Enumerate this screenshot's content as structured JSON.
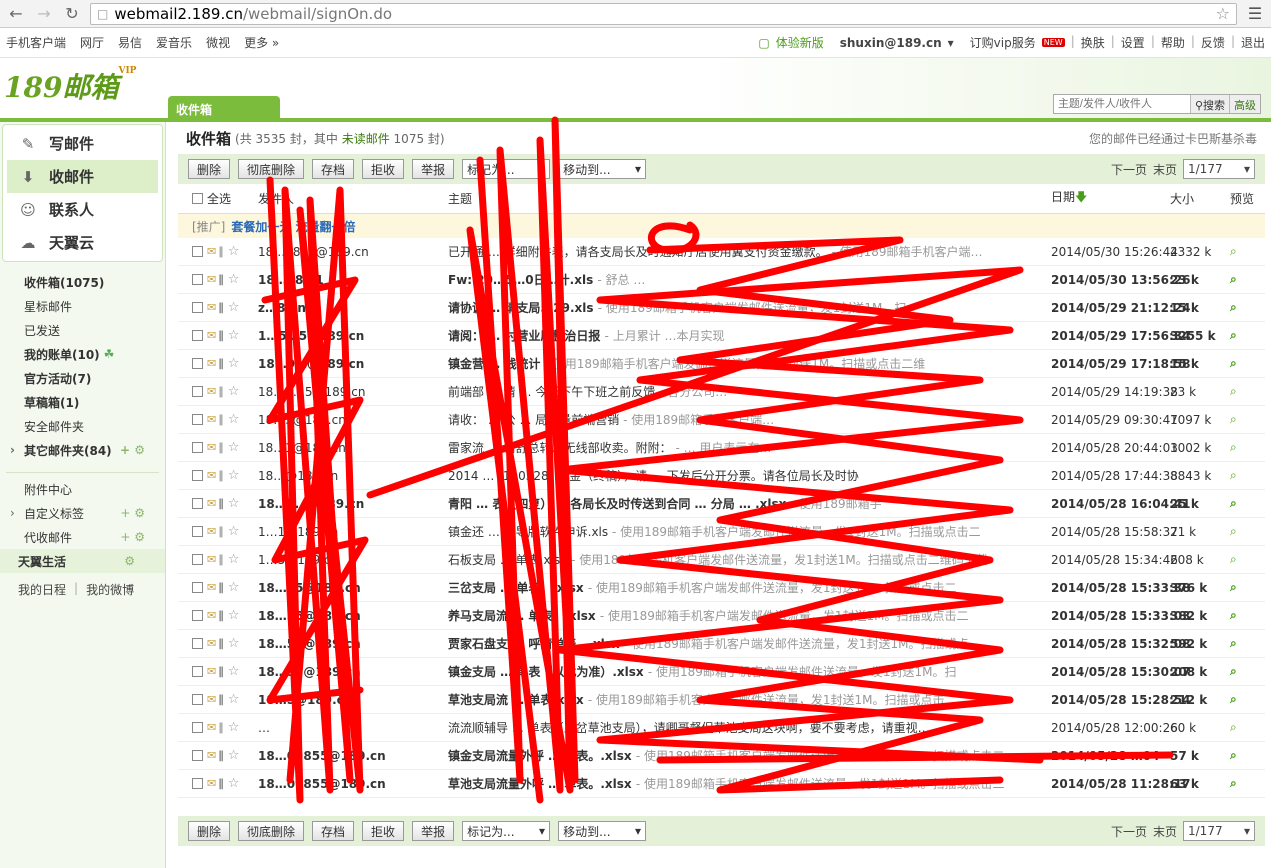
{
  "browser": {
    "url_domain": "webmail2.189.cn",
    "url_path": "/webmail/signOn.do"
  },
  "topnav": {
    "left": [
      "手机客户端",
      "网厅",
      "易信",
      "爱音乐",
      "微视",
      "更多 »"
    ],
    "new_version": "体验新版",
    "user": "shuxin@189.cn",
    "vip": "订购vip服务",
    "vip_badge": "NEW",
    "links": [
      "换肤",
      "设置",
      "帮助",
      "反馈",
      "退出"
    ]
  },
  "logo": {
    "num": "189",
    "text": "邮箱",
    "vip": "VIP"
  },
  "tab": "收件箱",
  "search": {
    "placeholder": "主题/发件人/收件人",
    "button": "搜索",
    "advanced": "高级"
  },
  "sidebar": {
    "actions": [
      {
        "icon": "compose-icon",
        "label": "写邮件"
      },
      {
        "icon": "receive-icon",
        "label": "收邮件"
      },
      {
        "icon": "contacts-icon",
        "label": "联系人"
      },
      {
        "icon": "cloud-icon",
        "label": "天翼云"
      }
    ],
    "folders": [
      {
        "label": "收件箱(1075)",
        "bold": true
      },
      {
        "label": "星标邮件",
        "bold": false
      },
      {
        "label": "已发送",
        "bold": false
      },
      {
        "label": "我的账单(10)",
        "bold": true
      },
      {
        "label": "官方活动(7)",
        "bold": true
      },
      {
        "label": "草稿箱(1)",
        "bold": true
      },
      {
        "label": "安全邮件夹",
        "bold": false
      },
      {
        "label": "其它邮件夹(84)",
        "bold": true
      }
    ],
    "extras": [
      "附件中心",
      "自定义标签",
      "代收邮件"
    ],
    "life": "天翼生活",
    "links": [
      "我的日程",
      "我的微博"
    ]
  },
  "main": {
    "title": "收件箱",
    "count_prefix": "(共 3535 封，其中",
    "unread": "未读邮件",
    "count_suffix": "1075 封)",
    "antivirus": "您的邮件已经通过卡巴斯基杀毒",
    "toolbar": {
      "delete": "删除",
      "perm_delete": "彻底删除",
      "archive": "存档",
      "reject": "拒收",
      "report": "举报",
      "mark": "标记为...",
      "move": "移动到...",
      "next": "下一页",
      "last": "末页",
      "page": "1/177"
    },
    "columns": {
      "select_all": "全选",
      "sender": "发件人",
      "subject": "主题",
      "date": "日期",
      "size": "大小",
      "preview": "预览"
    },
    "promo": {
      "tag": "[推广]",
      "text": "套餐加一元 流量翻一倍"
    },
    "rows": [
      {
        "bold": false,
        "sender": "18…9855@189.cn",
        "subject": "已开通 … 详细附件表，请各支局长及时通知厅店使用翼支付资金缴款。",
        "snippet": "- 使用189邮箱手机客户端…",
        "date": "2014/05/30 15:26:44",
        "size": "2332 k"
      },
      {
        "bold": true,
        "sender": "18…98…1",
        "subject": "Fw: 20…5…0日…计.xls",
        "snippet": "- 舒总 …",
        "date": "2014/05/30 13:56:26",
        "size": "23 k"
      },
      {
        "bold": true,
        "sender": "z…8…n",
        "subject": "请协调 … 请支局5.29.xls",
        "snippet": "- 使用189邮箱手机客户端发邮件送流量，发1封送1M。扫",
        "date": "2014/05/29 21:12:24",
        "size": "15 k"
      },
      {
        "bold": true,
        "sender": "1…5…5@189.cn",
        "subject": "请阅： … 村营业厅整治日报",
        "snippet": "- 上月累计 …本月实现",
        "date": "2014/05/29 17:56:34",
        "size": "3255 k"
      },
      {
        "bold": true,
        "sender": "18…9…@189.cn",
        "subject": "镇金营 … 线统计",
        "snippet": "- 使用189邮箱手机客户端发邮件送流量，发1封送1M。扫描或点击二维",
        "date": "2014/05/29 17:18:58",
        "size": "15 k"
      },
      {
        "bold": false,
        "sender": "18…9…5@189.cn",
        "subject": "前端部 … 请 … 今天下午下班之前反馈",
        "snippet": "- 各分公司…",
        "date": "2014/05/29 14:19:38",
        "size": "23 k"
      },
      {
        "bold": false,
        "sender": "18…3@189.cn",
        "subject": "请收： … 公 … 局流量前端营销",
        "snippet": "- 使用189邮箱手机客户端…",
        "date": "2014/05/29 09:30:47",
        "size": "1097 k"
      },
      {
        "bold": false,
        "sender": "18…1@189.cn",
        "subject": "雷家流 … 请舒总转发无线部收卖。附附：",
        "snippet": "- … 用户表示在…",
        "date": "2014/05/28 20:44:03",
        "size": "1002 k"
      },
      {
        "bold": false,
        "sender": "18…@189.cn",
        "subject": "2014 … (140528) 酬金（终稿），请 … 下发后分开分票。请各位局长及时协",
        "snippet": "",
        "date": "2014/05/28 17:44:38",
        "size": "8843 k"
      },
      {
        "bold": true,
        "sender": "18…5…@189.cn",
        "subject": "青阳 … 表（四复），请各局长及时传送到合同 … 分局 … .xlsx",
        "snippet": "- 使用189邮箱手",
        "date": "2014/05/28 16:04:41",
        "size": "25 k"
      },
      {
        "bold": false,
        "sender": "1…1@189.cn",
        "subject": "镇金还 … 辅导版软件申诉.xls",
        "snippet": "- 使用189邮箱手机客户端发邮件送流量，发1封送1M。扫描或点击二",
        "date": "2014/05/28 15:58:37",
        "size": "21 k"
      },
      {
        "bold": false,
        "sender": "1…5@189.cn",
        "subject": "石板支局 … 单表.xlsx",
        "snippet": "- 使用189邮箱手机客户端发邮件送流量，发1封送1M。扫描或点击二维码下载",
        "date": "2014/05/28 15:34:46",
        "size": "208 k"
      },
      {
        "bold": true,
        "sender": "18…55@189.cn",
        "subject": "三岔支局 … 单表。.xlsx",
        "snippet": "- 使用189邮箱手机客户端发邮件送流量，发1封送1M。扫描或点击二",
        "date": "2014/05/28 15:33:38",
        "size": "376 k"
      },
      {
        "bold": true,
        "sender": "18…55@189.cn",
        "subject": "养马支局流 … 单表。.xlsx",
        "snippet": "- 使用189邮箱手机客户端发邮件送流量，发1封送1M。扫描或点击二",
        "date": "2014/05/28 15:33:03",
        "size": "382 k"
      },
      {
        "bold": true,
        "sender": "18…55@189.cn",
        "subject": "贾家石盘支 … 呼清单表。.xlsx",
        "snippet": "- 使用189邮箱手机客户端发邮件送流量，发1封送1M。扫描或点",
        "date": "2014/05/28 15:32:08",
        "size": "592 k"
      },
      {
        "bold": true,
        "sender": "18…55@189.cn",
        "subject": "镇金支局 … 单表（以此为准）.xlsx",
        "snippet": "- 使用189邮箱手机客户端发邮件送流量，发1封送1M。扫",
        "date": "2014/05/28 15:30:07",
        "size": "208 k"
      },
      {
        "bold": true,
        "sender": "18…5@189.cn",
        "subject": "草池支局流 … 单表.xlsx",
        "snippet": "- 使用189邮箱手机客户端发邮件送流量，发1封送1M。扫描或点击二",
        "date": "2014/05/28 15:28:54",
        "size": "212 k"
      },
      {
        "bold": false,
        "sender": "…",
        "subject": "流流顺辅导 … 单表（三岔草池支局），请卿哥督促草池支局这块啊，要不要考虑，请重视…",
        "snippet": "",
        "date": "2014/05/28 12:00:26",
        "size": "60 k"
      },
      {
        "bold": true,
        "sender": "18…09855@189.cn",
        "subject": "镇金支局流量外呼 … 单表。.xlsx",
        "snippet": "- 使用189邮箱手机客户端发邮件送流量，发1封送1M。扫描或点击二",
        "date": "2014/05/28 …04",
        "size": "57 k"
      },
      {
        "bold": true,
        "sender": "18…09855@189.cn",
        "subject": "草池支局流量外呼 … 单表。.xlsx",
        "snippet": "- 使用189邮箱手机客户端发邮件送流量，发1封送1M。扫描或点击二",
        "date": "2014/05/28 11:28:17",
        "size": "63 k"
      }
    ]
  },
  "colors": {
    "accent": "#7cbc3c",
    "scribble": "#ff0000"
  }
}
